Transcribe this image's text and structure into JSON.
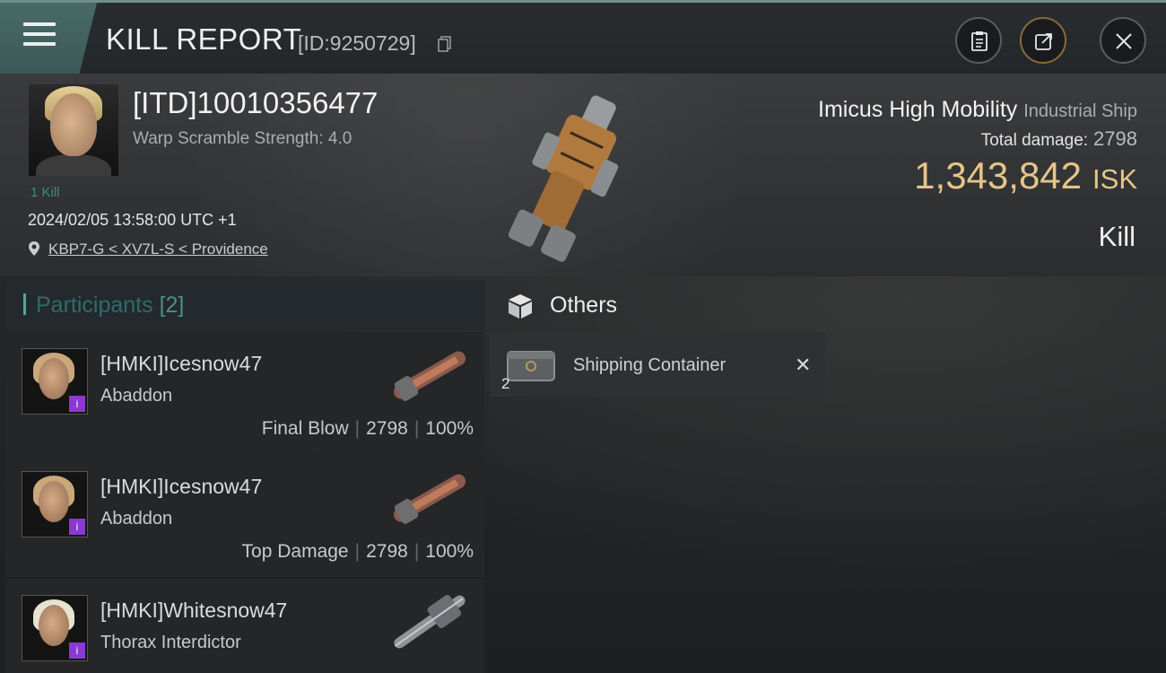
{
  "titlebar": {
    "title": "KILL REPORT",
    "report_id": "[ID:9250729]",
    "icons": [
      "menu-icon",
      "copy-icon",
      "clipboard-icon",
      "share-icon",
      "close-icon"
    ]
  },
  "victim": {
    "name": "[ITD]10010356477",
    "warp_scramble": "Warp Scramble Strength: 4.0",
    "kills": "1 Kill",
    "datetime": "2024/02/05 13:58:00 UTC +1",
    "location": "KBP7-G < XV7L-S < Providence",
    "ship_name": "Imicus High Mobility",
    "ship_class": "Industrial Ship",
    "total_damage_label": "Total damage:",
    "total_damage": "2798",
    "isk_value": "1,343,842",
    "isk_unit": "ISK",
    "result": "Kill"
  },
  "participants": {
    "label": "Participants",
    "count": "[2]",
    "rows": [
      {
        "name": "[HMKI]Icesnow47",
        "ship": "Abaddon",
        "tag": "Final Blow",
        "damage": "2798",
        "percent": "100%"
      },
      {
        "name": "[HMKI]Icesnow47",
        "ship": "Abaddon",
        "tag": "Top Damage",
        "damage": "2798",
        "percent": "100%"
      },
      {
        "name": "[HMKI]Whitesnow47",
        "ship": "Thorax Interdictor"
      }
    ]
  },
  "others": {
    "label": "Others",
    "items": [
      {
        "name": "Shipping Container",
        "qty": "2"
      }
    ]
  },
  "colors": {
    "accent_teal": "#4fa79c",
    "isk_gold": "#e6c58a",
    "badge_purple": "#8a3ad0"
  }
}
